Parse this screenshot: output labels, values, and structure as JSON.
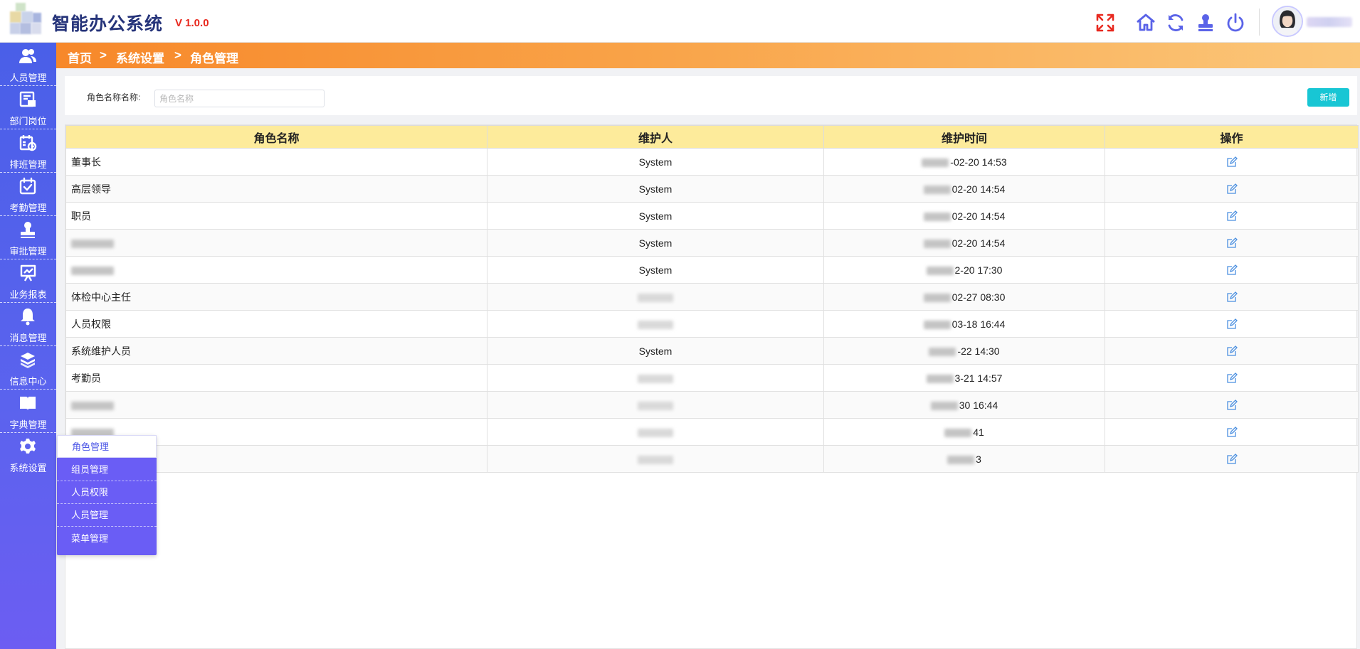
{
  "header": {
    "app_title": "智能办公系统",
    "version": "V 1.0.0",
    "icons": [
      "fullscreen-icon",
      "home-icon",
      "refresh-icon",
      "stamp-icon",
      "power-icon"
    ],
    "username": ""
  },
  "sidebar": {
    "items": [
      {
        "label": "人员管理",
        "icon": "people-icon"
      },
      {
        "label": "部门岗位",
        "icon": "department-icon"
      },
      {
        "label": "排班管理",
        "icon": "schedule-icon"
      },
      {
        "label": "考勤管理",
        "icon": "attendance-icon"
      },
      {
        "label": "审批管理",
        "icon": "approval-stamp-icon"
      },
      {
        "label": "业务报表",
        "icon": "report-icon"
      },
      {
        "label": "消息管理",
        "icon": "bell-icon"
      },
      {
        "label": "信息中心",
        "icon": "layers-icon"
      },
      {
        "label": "字典管理",
        "icon": "book-icon"
      },
      {
        "label": "系统设置",
        "icon": "gear-icon"
      }
    ]
  },
  "breadcrumb": {
    "home": "首页",
    "sep": ">",
    "level1": "系统设置",
    "level2": "角色管理"
  },
  "search": {
    "label": "角色名称名称:",
    "placeholder": "角色名称",
    "value": "",
    "add_label": "新增"
  },
  "table": {
    "columns": [
      "角色名称",
      "维护人",
      "维护时间",
      "操作"
    ],
    "rows": [
      {
        "name": "董事长",
        "maintainer": "System",
        "time": "-02-20 14:53"
      },
      {
        "name": "高层领导",
        "maintainer": "System",
        "time": "02-20 14:54"
      },
      {
        "name": "职员",
        "maintainer": "System",
        "time": "02-20 14:54"
      },
      {
        "name": "",
        "maintainer": "System",
        "time": "02-20 14:54"
      },
      {
        "name": "",
        "maintainer": "System",
        "time": "2-20 17:30"
      },
      {
        "name": "体检中心主任",
        "maintainer": "",
        "time": "02-27 08:30"
      },
      {
        "name": "人员权限",
        "maintainer": "",
        "time": "03-18 16:44"
      },
      {
        "name": "系统维护人员",
        "maintainer": "System",
        "time": "-22 14:30"
      },
      {
        "name": "考勤员",
        "maintainer": "",
        "time": "3-21 14:57"
      },
      {
        "name": "",
        "maintainer": "",
        "time": "30 16:44"
      },
      {
        "name": "",
        "maintainer": "",
        "time": "41"
      },
      {
        "name": "",
        "maintainer": "",
        "time": "3"
      }
    ]
  },
  "submenu": {
    "items": [
      "角色管理",
      "组员管理",
      "人员权限",
      "人员管理",
      "菜单管理"
    ],
    "active": "角色管理"
  },
  "colors": {
    "sidebar": "#4a5fe8",
    "breadcrumb": "#f7882a",
    "table_header": "#fdeb9b",
    "add_button": "#18c6d4",
    "accent_red": "#e8281e"
  }
}
